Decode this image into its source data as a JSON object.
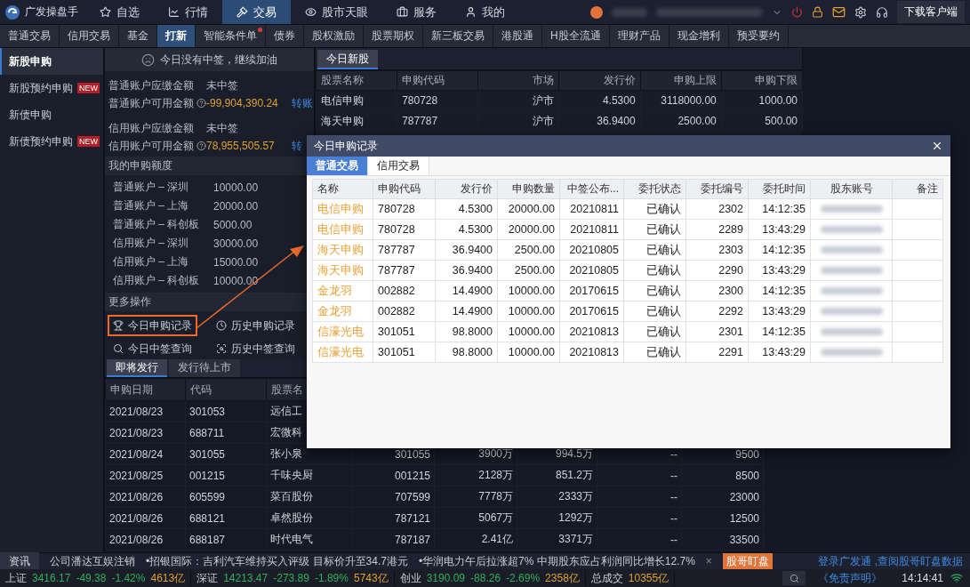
{
  "app": {
    "name": "广发操盘手"
  },
  "main_nav": [
    {
      "label": "自选",
      "selected": false
    },
    {
      "label": "行情",
      "selected": false
    },
    {
      "label": "交易",
      "selected": true
    },
    {
      "label": "股市天眼",
      "selected": false
    },
    {
      "label": "服务",
      "selected": false
    },
    {
      "label": "我的",
      "selected": false
    }
  ],
  "download_button": "下载客户端",
  "sub_nav": [
    {
      "label": "普通交易",
      "selected": false,
      "dot": false
    },
    {
      "label": "信用交易",
      "selected": false,
      "dot": false
    },
    {
      "label": "基金",
      "selected": false,
      "dot": false
    },
    {
      "label": "打新",
      "selected": true,
      "dot": false
    },
    {
      "label": "智能条件单",
      "selected": false,
      "dot": true
    },
    {
      "label": "债券",
      "selected": false,
      "dot": false
    },
    {
      "label": "股权激励",
      "selected": false,
      "dot": false
    },
    {
      "label": "股票期权",
      "selected": false,
      "dot": false
    },
    {
      "label": "新三板交易",
      "selected": false,
      "dot": false
    },
    {
      "label": "港股通",
      "selected": false,
      "dot": false
    },
    {
      "label": "H股全流通",
      "selected": false,
      "dot": false
    },
    {
      "label": "理财产品",
      "selected": false,
      "dot": false
    },
    {
      "label": "现金增利",
      "selected": false,
      "dot": false
    },
    {
      "label": "预受要约",
      "selected": false,
      "dot": false
    }
  ],
  "sidebar": [
    {
      "label": "新股申购",
      "selected": true
    },
    {
      "label": "新股预约申购",
      "selected": false,
      "badge": "NEW"
    },
    {
      "label": "新债申购",
      "selected": false
    },
    {
      "label": "新债预约申购",
      "selected": false,
      "badge": "NEW"
    }
  ],
  "notice": "今日没有中签，继续加油",
  "account_groups": [
    {
      "rows": [
        {
          "label": "普通账户应缴金额",
          "value": "未中签",
          "kind": "status"
        },
        {
          "label": "普通账户可用金额",
          "value": "-99,904,390.24",
          "kind": "amount",
          "link": "转账"
        }
      ]
    },
    {
      "rows": [
        {
          "label": "信用账户应缴金额",
          "value": "未中签",
          "kind": "status"
        },
        {
          "label": "信用账户可用金额",
          "value": "78,955,505.57",
          "kind": "amount",
          "link": "转"
        }
      ]
    }
  ],
  "quota": {
    "title": "我的申购额度",
    "rows": [
      {
        "label": "普通账户 – 深圳",
        "value": "10000.00"
      },
      {
        "label": "普通账户 – 上海",
        "value": "20000.00"
      },
      {
        "label": "普通账户 – 科创板",
        "value": "5000.00"
      },
      {
        "label": "信用账户 – 深圳",
        "value": "30000.00"
      },
      {
        "label": "信用账户 – 上海",
        "value": "15000.00"
      },
      {
        "label": "信用账户 – 科创板",
        "value": "10000.00"
      }
    ]
  },
  "more_ops": {
    "title": "更多操作",
    "actions": [
      {
        "label": "今日申购记录",
        "highlighted": true
      },
      {
        "label": "历史申购记录",
        "highlighted": false
      },
      {
        "label": "今日中签查询",
        "highlighted": false
      },
      {
        "label": "历史中签查询",
        "highlighted": false
      }
    ]
  },
  "today_new": {
    "tab": "今日新股",
    "columns": [
      "股票名称",
      "申购代码",
      "市场",
      "发行价",
      "申购上限",
      "申购下限"
    ],
    "rows": [
      [
        "电信申购",
        "780728",
        "沪市",
        "4.5300",
        "3118000.00",
        "1000.00"
      ],
      [
        "海天申购",
        "787787",
        "沪市",
        "36.9400",
        "2500.00",
        "500.00"
      ]
    ]
  },
  "upcoming": {
    "tabs": [
      {
        "label": "即将发行",
        "selected": true
      },
      {
        "label": "发行待上市",
        "selected": false
      }
    ],
    "columns": [
      "申购日期",
      "代码",
      "股票名"
    ],
    "rows": [
      [
        "2021/08/23",
        "301053",
        "远信工"
      ],
      [
        "2021/08/23",
        "688711",
        "宏微科"
      ],
      [
        "2021/08/24",
        "301055",
        "张小泉",
        "301055",
        "3900万",
        "994.5万",
        "--",
        "9500"
      ],
      [
        "2021/08/25",
        "001215",
        "千味央厨",
        "001215",
        "2128万",
        "851.2万",
        "--",
        "8500"
      ],
      [
        "2021/08/26",
        "605599",
        "菜百股份",
        "707599",
        "7778万",
        "2333万",
        "--",
        "23000"
      ],
      [
        "2021/08/26",
        "688121",
        "卓然股份",
        "787121",
        "5067万",
        "1292万",
        "--",
        "12500"
      ],
      [
        "2021/08/26",
        "688187",
        "时代电气",
        "787187",
        "2.41亿",
        "3371万",
        "--",
        "33500"
      ]
    ]
  },
  "dialog": {
    "title": "今日申购记录",
    "tabs": [
      {
        "label": "普通交易",
        "selected": true
      },
      {
        "label": "信用交易",
        "selected": false
      }
    ],
    "columns": [
      "名称",
      "申购代码",
      "发行价",
      "申购数量",
      "中签公布...",
      "委托状态",
      "委托编号",
      "委托时间",
      "股东账号",
      "备注"
    ],
    "rows": [
      [
        "电信申购",
        "780728",
        "4.5300",
        "20000.00",
        "20210811",
        "已确认",
        "2302",
        "14:12:35"
      ],
      [
        "电信申购",
        "780728",
        "4.5300",
        "20000.00",
        "20210811",
        "已确认",
        "2289",
        "13:43:29"
      ],
      [
        "海天申购",
        "787787",
        "36.9400",
        "2500.00",
        "20210805",
        "已确认",
        "2303",
        "14:12:35"
      ],
      [
        "海天申购",
        "787787",
        "36.9400",
        "2500.00",
        "20210805",
        "已确认",
        "2290",
        "13:43:29"
      ],
      [
        "金龙羽",
        "002882",
        "14.4900",
        "10000.00",
        "20170615",
        "已确认",
        "2300",
        "14:12:35"
      ],
      [
        "金龙羽",
        "002882",
        "14.4900",
        "10000.00",
        "20170615",
        "已确认",
        "2292",
        "13:43:29"
      ],
      [
        "信濠光电",
        "301051",
        "98.8000",
        "10000.00",
        "20210813",
        "已确认",
        "2301",
        "14:12:35"
      ],
      [
        "信濠光电",
        "301051",
        "98.8000",
        "10000.00",
        "20210813",
        "已确认",
        "2291",
        "13:43:29"
      ]
    ]
  },
  "news": {
    "label": "资讯",
    "items": [
      "公司潘达互娱注销",
      "•招银国际：吉利汽车维持买入评级 目标价升至34.7港元",
      "•华润电力午后拉涨超7% 中期股东应占利润同比增长12.7%"
    ],
    "close": "×",
    "button": "股哥盯盘",
    "login": "登录广发通 ,查阅股哥盯盘数据"
  },
  "indices": [
    {
      "name": "上证",
      "value": "3416.17",
      "change": "-49.38",
      "percent": "-1.42%",
      "amount": "4613亿"
    },
    {
      "name": "深证",
      "value": "14213.47",
      "change": "-273.89",
      "percent": "-1.89%",
      "amount": "5743亿"
    },
    {
      "name": "创业",
      "value": "3190.09",
      "change": "-88.26",
      "percent": "-2.69%",
      "amount": "2358亿"
    }
  ],
  "turnover": {
    "label": "总成交",
    "value": "10355亿"
  },
  "disclaimer": "《免责声明》",
  "time": "14:14:41"
}
